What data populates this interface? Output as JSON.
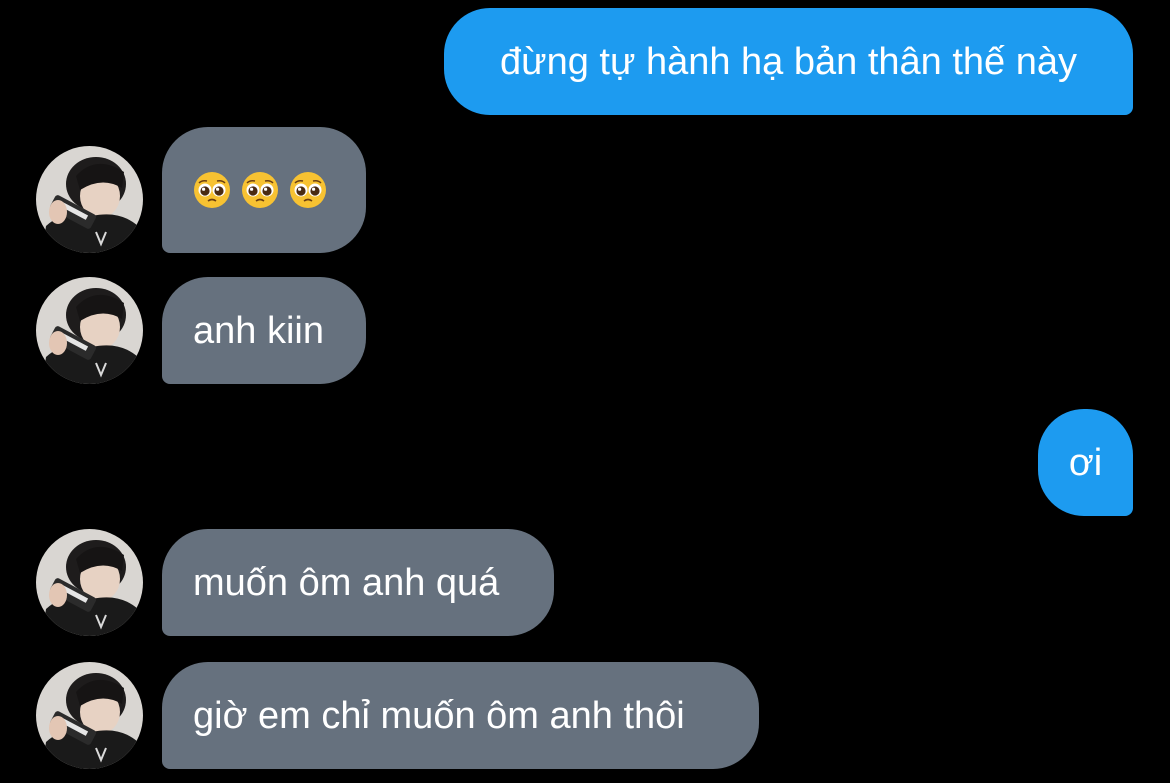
{
  "messages": [
    {
      "id": "m1",
      "direction": "outgoing",
      "text": "đừng tự hành hạ bản thân thế này"
    },
    {
      "id": "m2",
      "direction": "incoming",
      "emoji": [
        "pleading-face-emoji",
        "pleading-face-emoji",
        "pleading-face-emoji"
      ]
    },
    {
      "id": "m3",
      "direction": "incoming",
      "text": "anh kiin"
    },
    {
      "id": "m4",
      "direction": "outgoing",
      "text": "ơi"
    },
    {
      "id": "m5",
      "direction": "incoming",
      "text": "muốn ôm anh quá"
    },
    {
      "id": "m6",
      "direction": "incoming",
      "text": "giờ em chỉ muốn ôm anh thôi"
    }
  ],
  "colors": {
    "background": "#000000",
    "outgoing_bubble": "#1d9bf0",
    "incoming_bubble": "#66717e",
    "text": "#ffffff"
  },
  "avatar_icon": "contact-avatar-photo"
}
